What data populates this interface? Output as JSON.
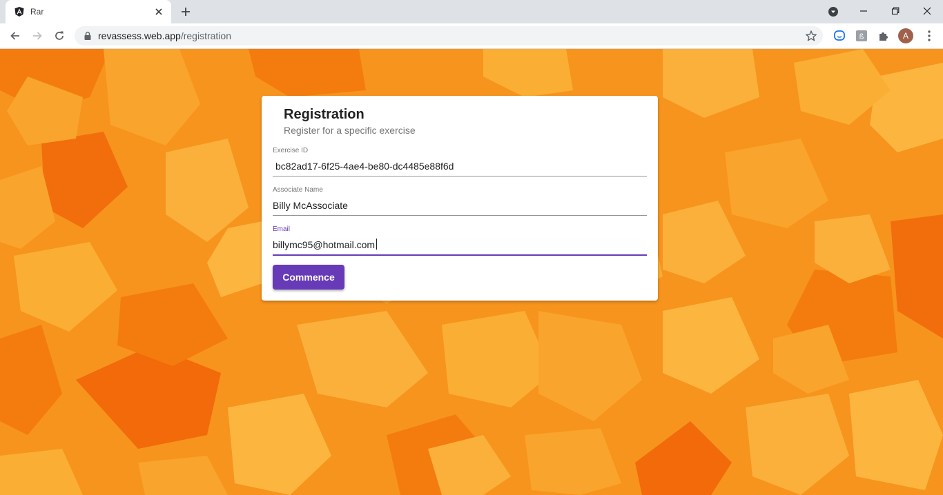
{
  "browser": {
    "tab_title": "Rar",
    "url_domain": "revassess.web.app",
    "url_path": "/registration",
    "profile_initial": "A",
    "icons": {
      "favicon": "angular-logo-icon",
      "tab_close": "close-icon",
      "new_tab": "plus-icon",
      "tab_search": "chevron-down-icon",
      "back": "arrow-left-icon",
      "forward": "arrow-right-icon",
      "reload": "reload-icon",
      "lock": "lock-icon",
      "bookmark": "star-icon",
      "extensions": [
        "chat-extension-icon",
        "translate-extension-icon",
        "puzzle-icon"
      ],
      "menu": "more-vert-icon"
    }
  },
  "registration": {
    "title": "Registration",
    "subtitle": "Register for a specific exercise",
    "fields": [
      {
        "label": "Exercise ID",
        "value": "bc82ad17-6f25-4ae4-be80-dc4485e88f6d"
      },
      {
        "label": "Associate Name",
        "value": "Billy McAssociate"
      },
      {
        "label": "Email",
        "value": "billymc95@hotmail.com"
      }
    ],
    "submit_label": "Commence"
  },
  "colors": {
    "accent": "#673ab7",
    "background_orange": "#f7941d",
    "background_light": "#fbb03b",
    "background_dark": "#f47c0f"
  }
}
